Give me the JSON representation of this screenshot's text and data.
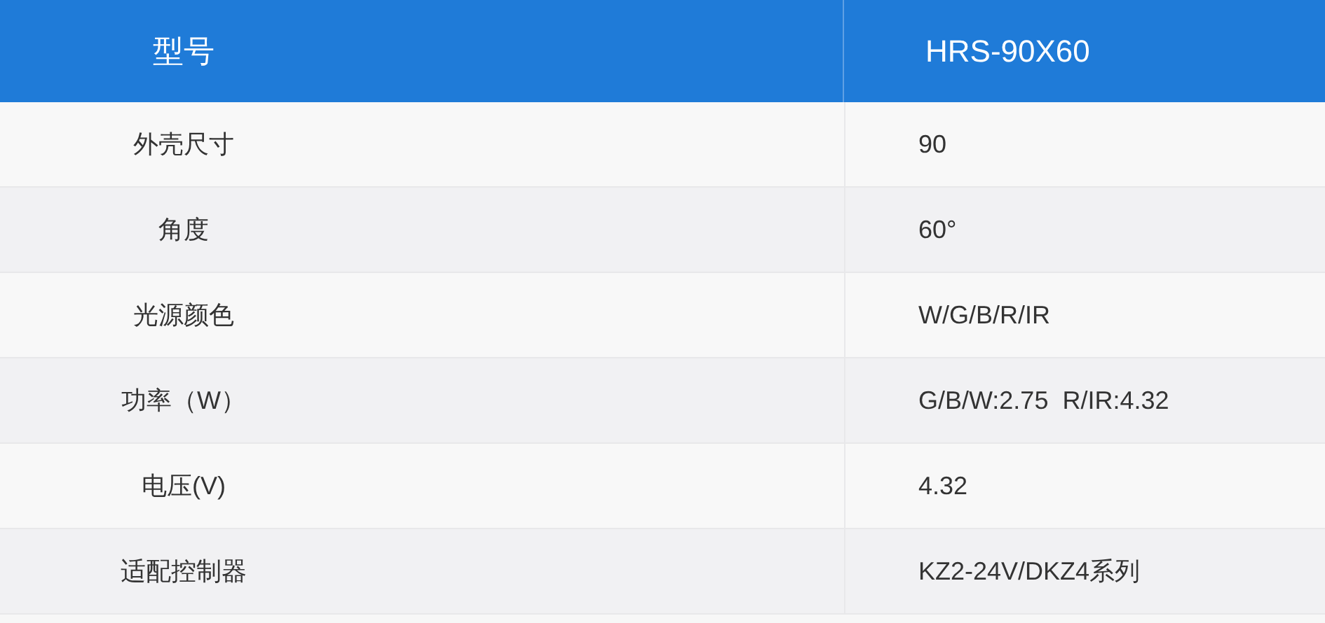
{
  "table": {
    "columns": [
      "型号",
      "HRS-90X60"
    ],
    "rows": [
      {
        "cells": [
          "外壳尺寸",
          "90"
        ]
      },
      {
        "cells": [
          "角度",
          "60°"
        ]
      },
      {
        "cells": [
          "光源颜色",
          "W/G/B/R/IR"
        ]
      },
      {
        "cells": [
          "功率（W）",
          "G/B/W:2.75  R/IR:4.32"
        ]
      },
      {
        "cells": [
          "电压(V)",
          "4.32"
        ]
      },
      {
        "cells": [
          "适配控制器",
          "KZ2-24V/DKZ4系列"
        ]
      }
    ]
  }
}
